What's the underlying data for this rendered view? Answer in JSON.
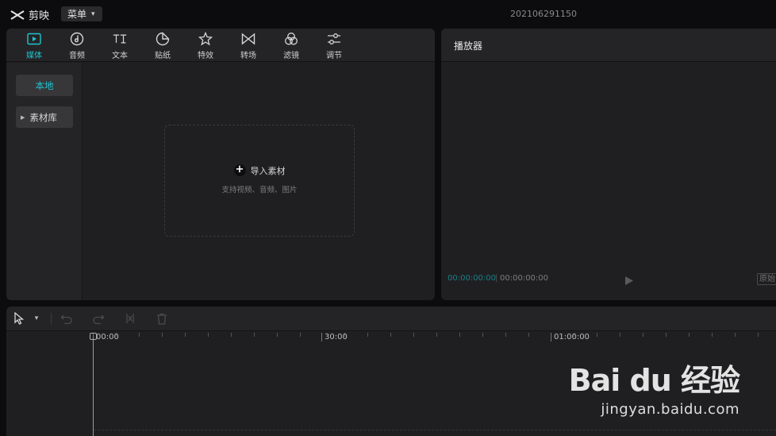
{
  "app": {
    "name": "剪映",
    "menu_label": "菜单",
    "project_title": "202106291150"
  },
  "media": {
    "tabs": [
      {
        "label": "媒体",
        "icon": "media-play-icon",
        "active": true
      },
      {
        "label": "音频",
        "icon": "audio-note-icon",
        "active": false
      },
      {
        "label": "文本",
        "icon": "text-ti-icon",
        "active": false
      },
      {
        "label": "贴纸",
        "icon": "sticker-icon",
        "active": false
      },
      {
        "label": "特效",
        "icon": "effects-star-icon",
        "active": false
      },
      {
        "label": "转场",
        "icon": "transition-bowtie-icon",
        "active": false
      },
      {
        "label": "滤镜",
        "icon": "filter-circles-icon",
        "active": false
      },
      {
        "label": "调节",
        "icon": "adjust-sliders-icon",
        "active": false
      }
    ],
    "sidebar": {
      "local": "本地",
      "library": "素材库"
    },
    "import": {
      "label": "导入素材",
      "hint": "支持视频、音频、图片"
    }
  },
  "player": {
    "title": "播放器",
    "current_time": "00:00:00:00",
    "separator": "|",
    "total_time": "00:00:00:00",
    "ratio_label": "原始"
  },
  "timeline": {
    "ruler_labels": [
      "00:00",
      "30:00",
      "01:00:00"
    ]
  },
  "watermark": {
    "brand": "Bai du 经验",
    "url": "jingyan.baidu.com"
  },
  "colors": {
    "accent": "#20c4cf",
    "panel": "#1f1f21",
    "background": "#0c0c0e"
  }
}
